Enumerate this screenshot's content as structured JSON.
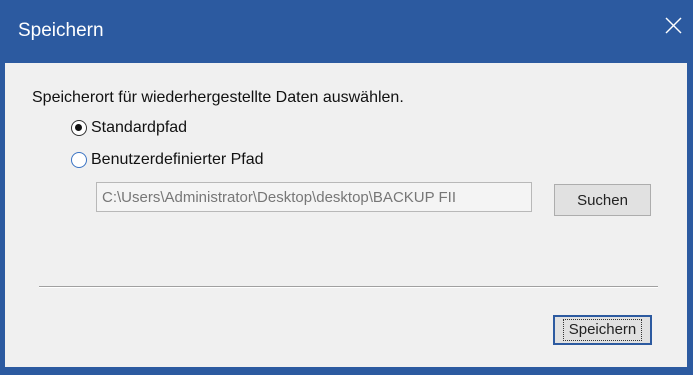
{
  "dialog": {
    "title": "Speichern",
    "close_icon": "close-icon",
    "prompt": "Speicherort für wiederhergestellte Daten auswählen.",
    "options": [
      {
        "label": "Standardpfad",
        "selected": true
      },
      {
        "label": "Benutzerdefinierter Pfad",
        "selected": false
      }
    ],
    "path_value": "C:\\Users\\Administrator\\Desktop\\desktop\\BACKUP FII",
    "search_label": "Suchen",
    "save_label": "Speichern"
  },
  "colors": {
    "title_bar": "#2c5aa0",
    "background": "#f0f0f0",
    "button": "#e1e1e1"
  }
}
